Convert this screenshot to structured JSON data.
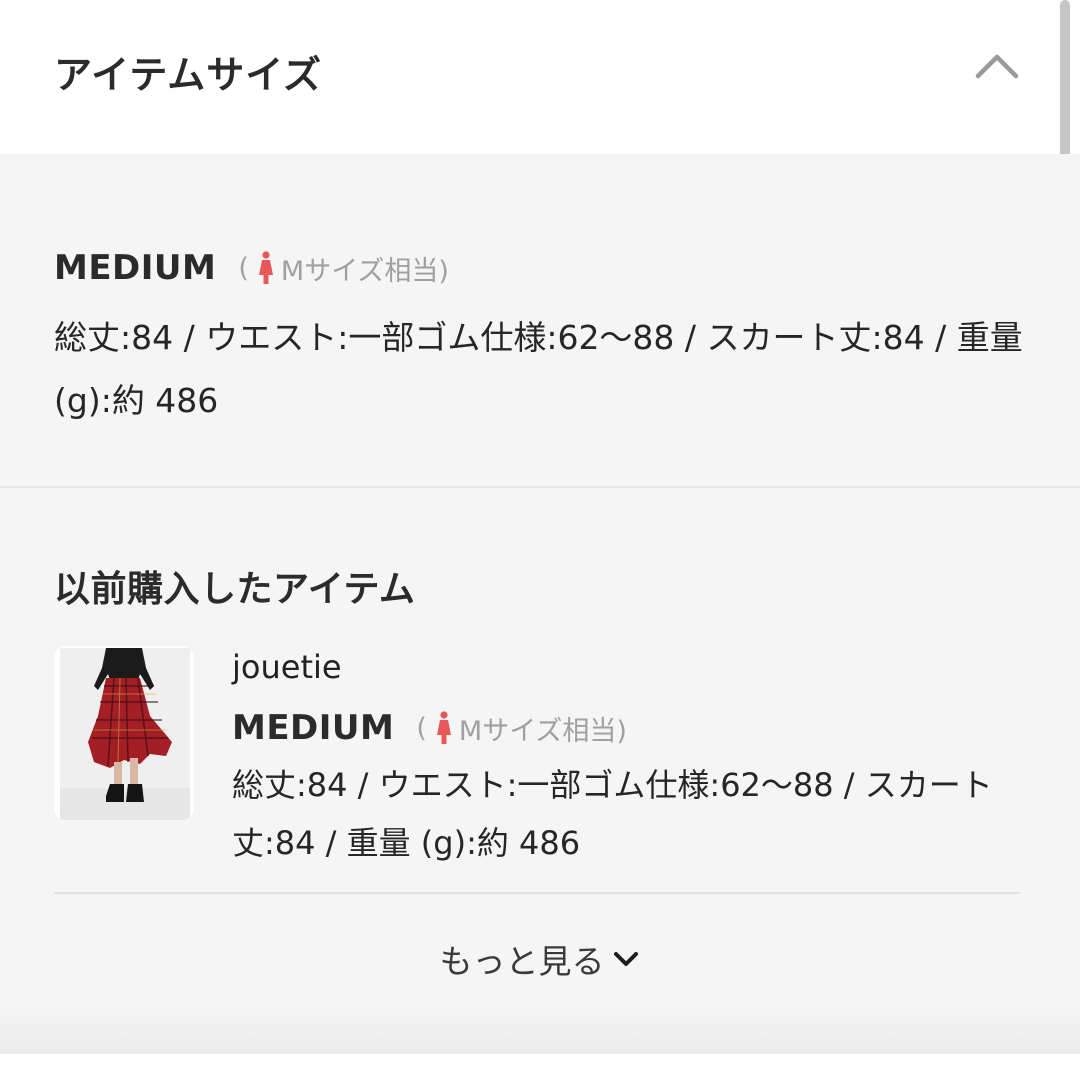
{
  "section": {
    "title": "アイテムサイズ",
    "collapse_icon": "chevron-up-icon"
  },
  "current_size": {
    "name": "MEDIUM",
    "note_open": "(",
    "note_text": "Mサイズ相当)",
    "details": "総丈:84 / ウエスト:一部ゴム仕様:62〜88 / スカート丈:84 / 重量 (g):約 486"
  },
  "previous": {
    "title": "以前購入したアイテム",
    "item": {
      "brand": "jouetie",
      "size_name": "MEDIUM",
      "note_open": "(",
      "note_text": "Mサイズ相当)",
      "details": "総丈:84 / ウエスト:一部ゴム仕様:62〜88 / スカート丈:84 / 重量 (g):約 486",
      "image_icon": "skirt-photo"
    },
    "more_label": "もっと見る"
  },
  "colors": {
    "accent": "#e8575a",
    "panel_bg": "#f5f5f5",
    "muted_text": "#a0a0a0"
  }
}
